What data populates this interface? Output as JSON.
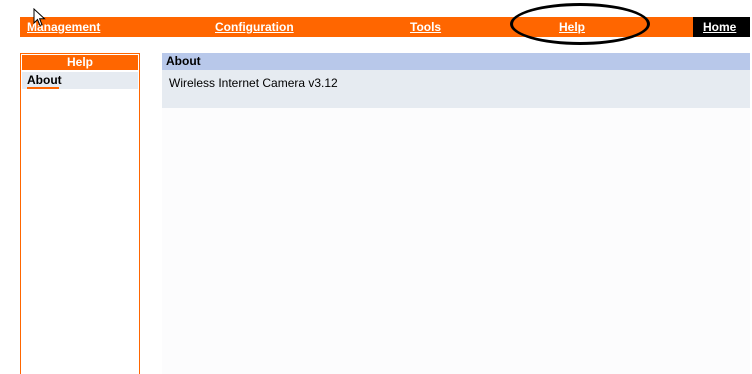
{
  "navbar": {
    "items": [
      {
        "label": "Management"
      },
      {
        "label": "Configuration"
      },
      {
        "label": "Tools"
      },
      {
        "label": "Help"
      },
      {
        "label": "Home"
      }
    ]
  },
  "sidebar": {
    "header": "Help",
    "items": [
      {
        "label": "About"
      }
    ]
  },
  "main": {
    "title": "About",
    "version_text": "Wireless Internet Camera v3.12"
  },
  "colors": {
    "nav_background": "#ff6600",
    "home_background": "#000000",
    "content_header": "#b8c8ea",
    "content_body": "#e6ebf1"
  }
}
